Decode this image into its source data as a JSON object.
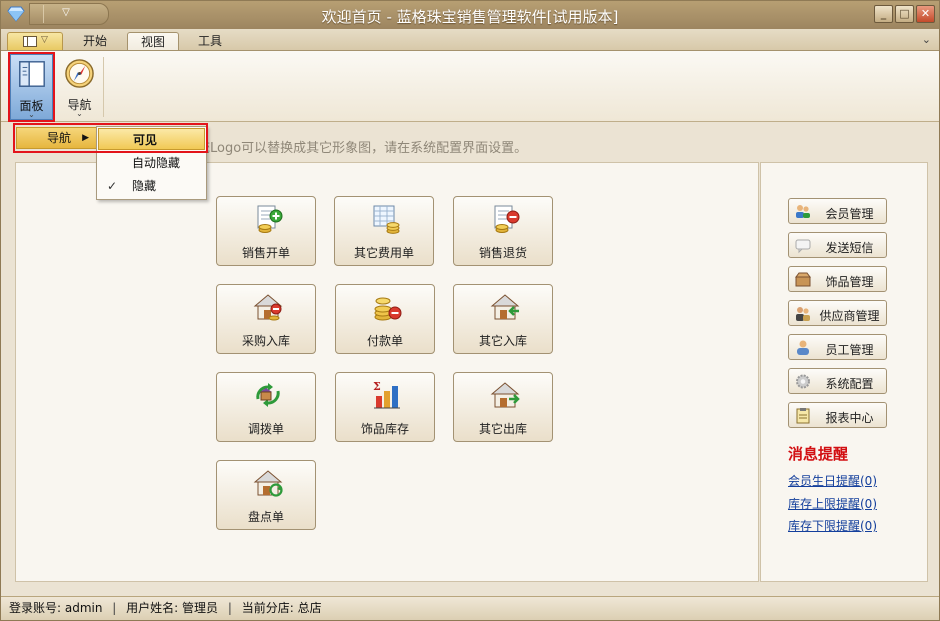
{
  "window": {
    "title": "欢迎首页 - 蓝格珠宝销售管理软件[试用版本]"
  },
  "ribbon": {
    "tabs": [
      {
        "label": "开始"
      },
      {
        "label": "视图"
      },
      {
        "label": "工具"
      }
    ],
    "active_tab": "视图",
    "buttons": {
      "panel": "面板",
      "navigation": "导航"
    }
  },
  "menus": {
    "panel_menu_item": "导航",
    "submenu": [
      {
        "label": "可见",
        "highlighted": true
      },
      {
        "label": "自动隐藏"
      },
      {
        "label": "隐藏",
        "checked": true
      }
    ]
  },
  "content": {
    "banner_partial": "统Logo可以替换成其它形象图，请在系统配置界面设置。",
    "tiles": [
      {
        "label": "销售开单",
        "icon": "sales-doc-add-icon"
      },
      {
        "label": "其它费用单",
        "icon": "fee-sheet-coins-icon"
      },
      {
        "label": "销售退货",
        "icon": "sales-return-icon"
      },
      {
        "label": "采购入库",
        "icon": "purchase-inbound-icon"
      },
      {
        "label": "付款单",
        "icon": "payment-coins-icon"
      },
      {
        "label": "其它入库",
        "icon": "other-inbound-icon"
      },
      {
        "label": "调拨单",
        "icon": "transfer-icon"
      },
      {
        "label": "饰品库存",
        "icon": "inventory-chart-icon"
      },
      {
        "label": "其它出库",
        "icon": "other-outbound-icon"
      },
      {
        "label": "盘点单",
        "icon": "stocktake-icon"
      }
    ],
    "side_buttons": [
      {
        "label": "会员管理",
        "icon": "members-icon"
      },
      {
        "label": "发送短信",
        "icon": "sms-icon"
      },
      {
        "label": "饰品管理",
        "icon": "jewelry-box-icon"
      },
      {
        "label": "供应商管理",
        "icon": "supplier-icon"
      },
      {
        "label": "员工管理",
        "icon": "employee-icon"
      },
      {
        "label": "系统配置",
        "icon": "gear-icon"
      },
      {
        "label": "报表中心",
        "icon": "report-clipboard-icon"
      }
    ],
    "messages": {
      "title": "消息提醒",
      "links": [
        "会员生日提醒(0)",
        "库存上限提醒(0)",
        "库存下限提醒(0)"
      ]
    }
  },
  "status": {
    "login_label": "登录账号: admin",
    "user_label": "用户姓名: 管理员",
    "branch_label": "当前分店: 总店",
    "separator": "|"
  },
  "colors": {
    "accent_red": "#e3141b",
    "highlight_yellow": "#f1c955",
    "link_blue": "#143f9c",
    "message_red": "#d20f12"
  }
}
